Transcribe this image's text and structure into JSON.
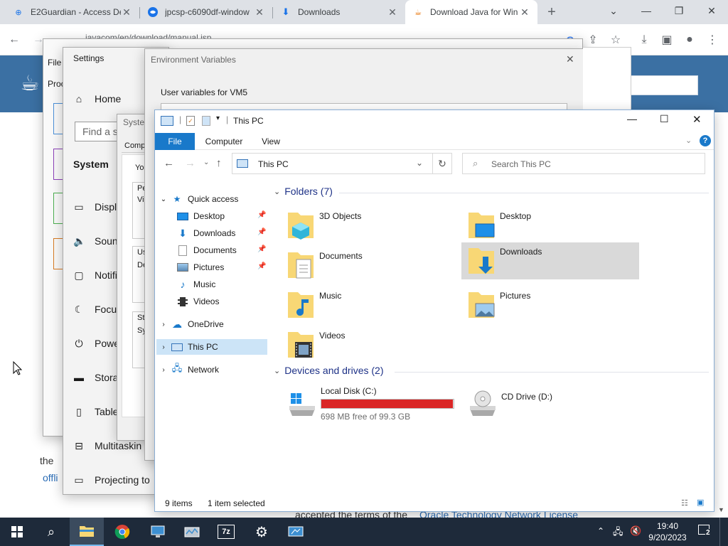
{
  "chrome": {
    "tabs": [
      {
        "label": "E2Guardian - Access De",
        "icon": "e2guardian-icon",
        "active": false
      },
      {
        "label": "jpcsp-c6090df-window",
        "icon": "github-icon",
        "active": false
      },
      {
        "label": "Downloads",
        "icon": "download-icon",
        "active": false
      },
      {
        "label": "Download Java for Win",
        "icon": "java-icon",
        "active": true
      }
    ],
    "address_text": "javacom/en/download/manual.jsp"
  },
  "java_page": {
    "text_lines": [
      "offli",
      "the",
      "accepted the terms of the",
      "Oracle Technology Network License"
    ]
  },
  "settings": {
    "title": "Settings",
    "home_label": "Home",
    "search_placeholder": "Find a s",
    "section": "System",
    "items": [
      "Displ",
      "Soun",
      "Notifi",
      "Focu",
      "Powe",
      "Stora",
      "Table",
      "Multitaskin",
      "Projecting to"
    ]
  },
  "env_vars": {
    "title": "Environment Variables",
    "user_vars_label": "User variables for VM5"
  },
  "system_props": {
    "title": "Syste",
    "tab": "Comp",
    "lines": [
      "You",
      "Pe",
      "Vi",
      "Us",
      "De",
      "St",
      "Sy"
    ]
  },
  "explorer": {
    "title": "This PC",
    "ribbon_tabs": [
      "File",
      "Computer",
      "View"
    ],
    "breadcrumb": "This PC",
    "search_placeholder": "Search This PC",
    "nav": {
      "quick_access": "Quick access",
      "quick_items": [
        "Desktop",
        "Downloads",
        "Documents",
        "Pictures",
        "Music",
        "Videos"
      ],
      "onedrive": "OneDrive",
      "this_pc": "This PC",
      "network": "Network"
    },
    "folders_header": "Folders (7)",
    "folders": [
      "3D Objects",
      "Desktop",
      "Documents",
      "Downloads",
      "Music",
      "Pictures",
      "Videos"
    ],
    "drives_header": "Devices and drives (2)",
    "drives": [
      {
        "name": "Local Disk (C:)",
        "free": "698 MB free of 99.3 GB",
        "used_fraction": 0.993
      },
      {
        "name": "CD Drive (D:)"
      }
    ],
    "status_items": "9 items",
    "status_selected": "1 item selected"
  },
  "taskbar": {
    "time": "19:40",
    "date": "9/20/2023",
    "notification_count": "2"
  },
  "colors": {
    "java_blue": "#3b70a3",
    "explorer_accent": "#1979ca",
    "drive_full": "#da2626",
    "taskbar": "#1e2a3a",
    "selection": "#cce4f7"
  }
}
